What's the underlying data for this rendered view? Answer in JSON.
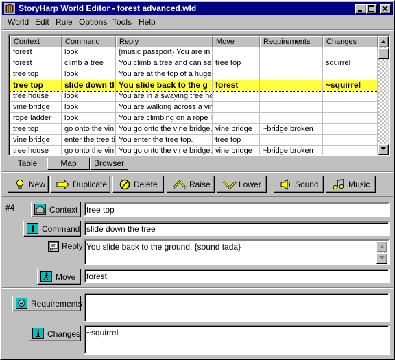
{
  "window": {
    "title": "StoryHarp World Editor - forest advanced.wld"
  },
  "menu": [
    "World",
    "Edit",
    "Rule",
    "Options",
    "Tools",
    "Help"
  ],
  "table": {
    "columns": [
      "Context",
      "Command",
      "Reply",
      "Move",
      "Requirements",
      "Changes"
    ],
    "rows": [
      [
        "forest",
        "look",
        "{music passport} You are in",
        "",
        "",
        ""
      ],
      [
        "forest",
        "climb a tree",
        "You climb a tree and can se",
        "tree top",
        "",
        "squirrel"
      ],
      [
        "tree top",
        "look",
        "You are at the top of a huge",
        "",
        "",
        ""
      ],
      [
        "tree top",
        "slide down tl",
        "You slide back to the g",
        "forest",
        "",
        "~squirrel"
      ],
      [
        "tree house",
        "look",
        "You are in a swaying tree hc",
        "",
        "",
        ""
      ],
      [
        "vine bridge",
        "look",
        "You are walking across a vir",
        "",
        "",
        ""
      ],
      [
        "rope ladder",
        "look",
        "You are climbing on a rope la",
        "",
        "",
        ""
      ],
      [
        "tree top",
        "go onto the vin",
        "You go onto the vine bridge.",
        "vine bridge",
        "~bridge broken",
        ""
      ],
      [
        "vine bridge",
        "enter the tree ti",
        "You enter the tree top.",
        "tree top",
        "",
        ""
      ],
      [
        "tree house",
        "go onto the vin",
        "You go onto the vine bridge.",
        "vine bridge",
        "~bridge broken",
        ""
      ]
    ],
    "selected_row": 3
  },
  "tabs": [
    "Table",
    "Map",
    "Browser"
  ],
  "active_tab": "Table",
  "toolbar": {
    "new": "New",
    "duplicate": "Duplicate",
    "delete": "Delete",
    "raise": "Raise",
    "lower": "Lower",
    "sound": "Sound",
    "music": "Music"
  },
  "detail": {
    "rule_number": "#4",
    "context_label": "Context",
    "context_value": "tree top",
    "command_label": "Command",
    "command_value": "slide down the tree",
    "reply_label": "Reply",
    "reply_value": "You slide back to the ground. {sound tada}",
    "move_label": "Move",
    "move_value": "forest",
    "requirements_label": "Requirements",
    "requirements_value": "",
    "changes_label": "Changes",
    "changes_value": "~squirrel"
  },
  "colors": {
    "titlebar": "#000080",
    "selected_row": "#ffff40",
    "field_icon": "#00c0c0"
  }
}
